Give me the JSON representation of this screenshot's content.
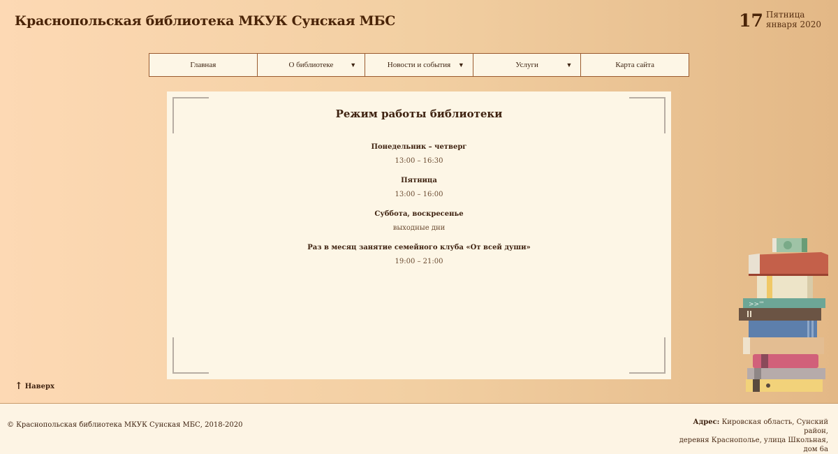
{
  "header": {
    "title": "Краснопольская библиотека МКУК Сунская МБС",
    "date_day": "17",
    "date_weekday": "Пятница",
    "date_month_year": "января 2020"
  },
  "nav": [
    {
      "label": "Главная",
      "has_dropdown": false
    },
    {
      "label": "О библиотеке",
      "has_dropdown": true
    },
    {
      "label": "Новости и события",
      "has_dropdown": true
    },
    {
      "label": "Услуги",
      "has_dropdown": true
    },
    {
      "label": "Карта сайта",
      "has_dropdown": false
    }
  ],
  "nav_arrow": "▼",
  "main": {
    "title": "Режим работы библиотеки",
    "schedule": [
      {
        "heading": "Понедельник – четверг",
        "value": "13:00 – 16:30"
      },
      {
        "heading": "Пятница",
        "value": "13:00 – 16:00"
      },
      {
        "heading": "Суббота, воскресенье",
        "value": "выходные дни"
      },
      {
        "heading": "Раз в месяц занятие семейного клуба «От всей души»",
        "value": "19:00 – 21:00"
      }
    ]
  },
  "to_top": {
    "arrow": "↑",
    "label": "Наверх"
  },
  "footer": {
    "copyright": "© Краснопольская библиотека МКУК Сунская МБС, 2018-2020",
    "address_label": "Адрес:",
    "address_line1": "Кировская область, Сунский район,",
    "address_line2": "деревня Краснополье, улица Школьная, дом 6а"
  },
  "colors": {
    "accent": "#4a2408",
    "nav_border": "#9a5a2e",
    "panel_bg": "#fdf6e6"
  }
}
